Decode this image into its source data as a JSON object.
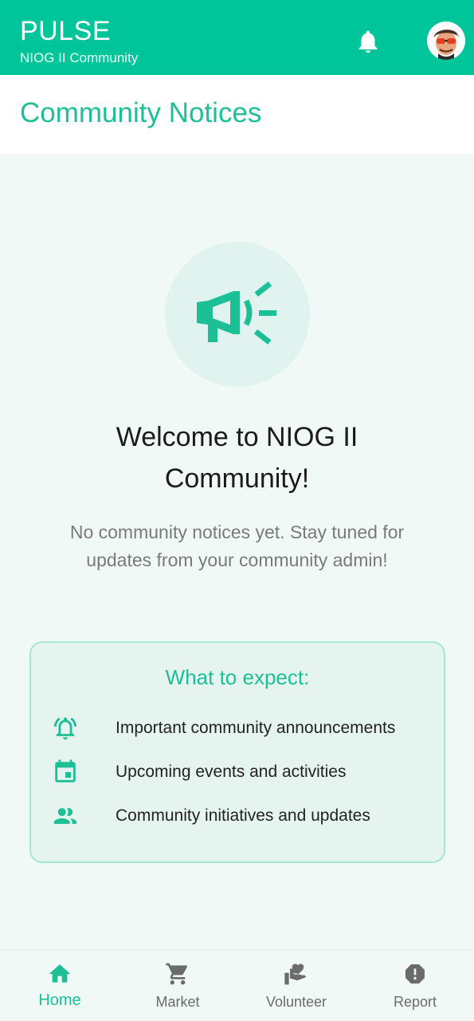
{
  "appbar": {
    "title": "PULSE",
    "subtitle": "NIOG II Community",
    "bell_icon": "bell-icon",
    "avatar_icon": "user-avatar"
  },
  "page": {
    "heading": "Community Notices"
  },
  "hero": {
    "icon": "megaphone-icon",
    "welcome": "Welcome to NIOG II Community!",
    "message": "No community notices yet. Stay tuned for updates from your community admin!"
  },
  "expect": {
    "title": "What to expect:",
    "items": [
      {
        "icon": "alarm-bell-icon",
        "label": "Important community announcements"
      },
      {
        "icon": "calendar-icon",
        "label": "Upcoming events and activities"
      },
      {
        "icon": "people-icon",
        "label": "Community initiatives and updates"
      }
    ]
  },
  "nav": {
    "items": [
      {
        "label": "Home",
        "icon": "home-icon",
        "active": true
      },
      {
        "label": "Market",
        "icon": "cart-icon",
        "active": false
      },
      {
        "label": "Volunteer",
        "icon": "volunteer-hand-heart-icon",
        "active": false
      },
      {
        "label": "Report",
        "icon": "alert-icon",
        "active": false
      }
    ]
  },
  "colors": {
    "primary": "#00c59a",
    "accent_text": "#1dbf97",
    "background": "#f1f9f6"
  }
}
